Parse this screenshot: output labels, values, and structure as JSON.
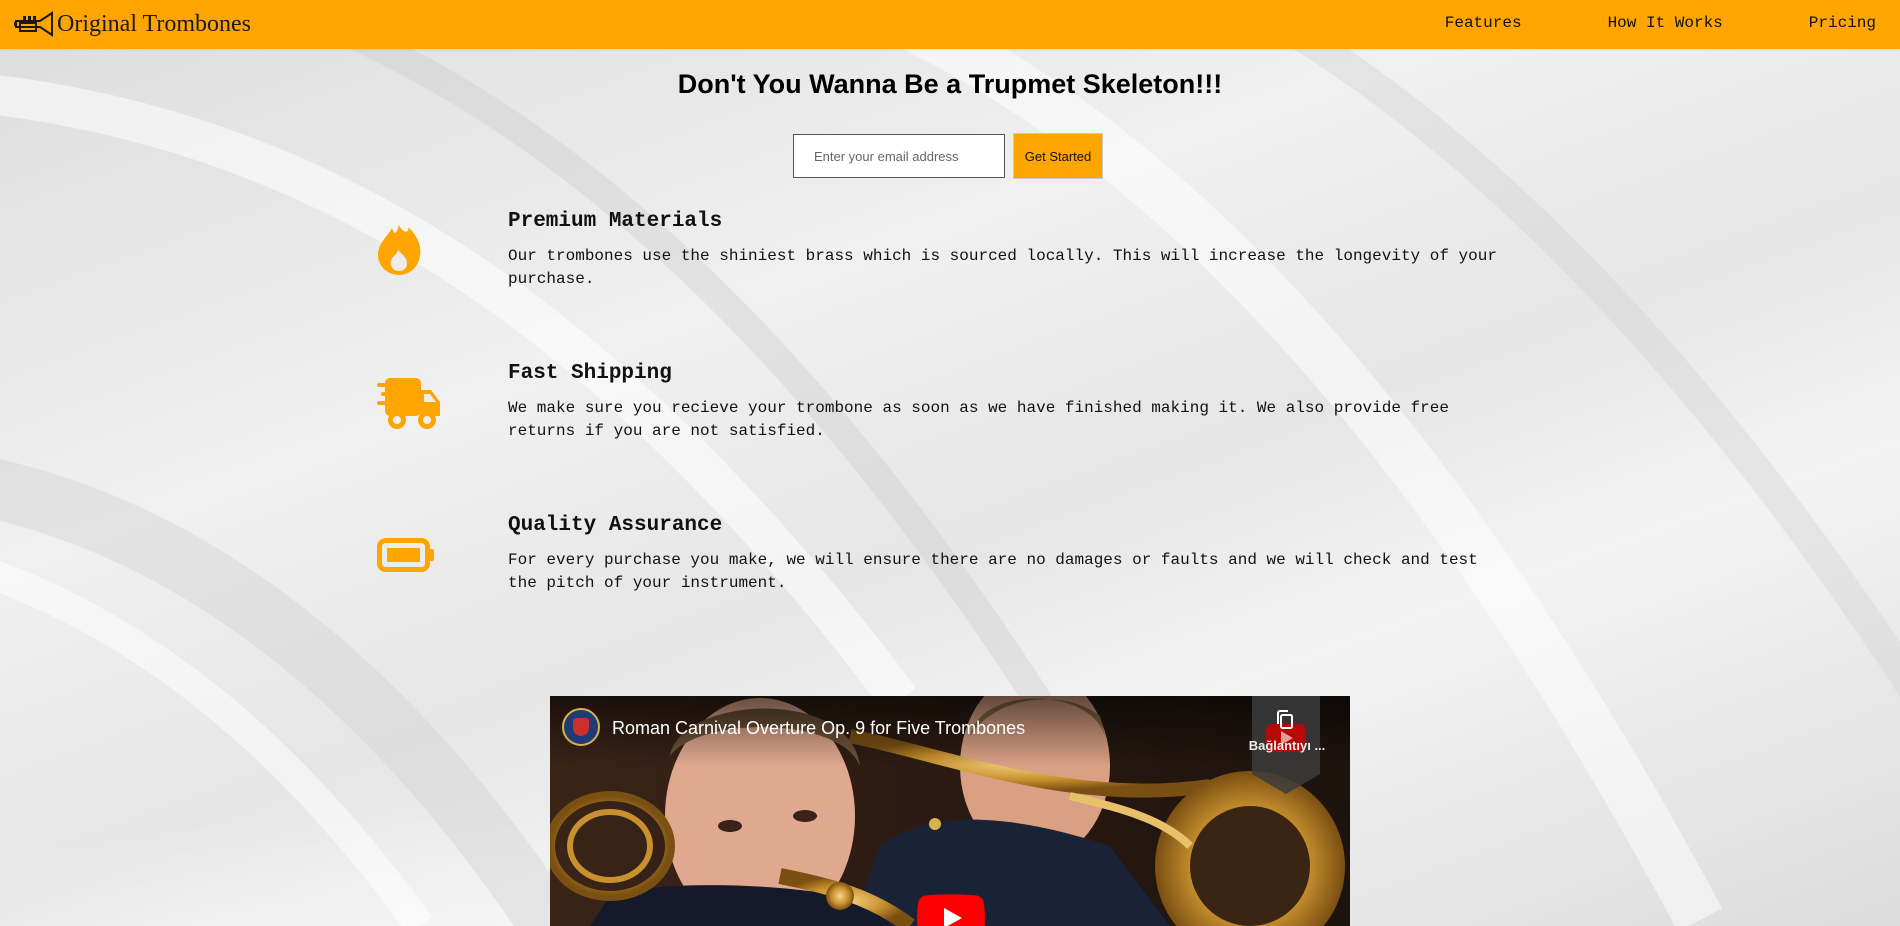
{
  "header": {
    "logo_text": "Original Trombones",
    "nav": [
      "Features",
      "How It Works",
      "Pricing"
    ]
  },
  "hero": {
    "title": "Don't You Wanna Be a Trupmet Skeleton!!!",
    "email_placeholder": "Enter your email address",
    "cta_label": "Get Started"
  },
  "features": [
    {
      "icon": "fire-icon",
      "title": "Premium Materials",
      "description": "Our trombones use the shiniest brass which is sourced locally. This will increase the longevity of your purchase."
    },
    {
      "icon": "truck-icon",
      "title": "Fast Shipping",
      "description": "We make sure you recieve your trombone as soon as we have finished making it. We also provide free returns if you are not satisfied."
    },
    {
      "icon": "battery-icon",
      "title": "Quality Assurance",
      "description": "For every purchase you make, we will ensure there are no damages or faults and we will check and test the pitch of your instrument."
    }
  ],
  "video": {
    "title": "Roman Carnival Overture Op. 9 for Five Trombones",
    "share_label": "Bağlantıyı ..."
  },
  "colors": {
    "accent": "#ffa500",
    "youtube_red": "#ff0000"
  }
}
